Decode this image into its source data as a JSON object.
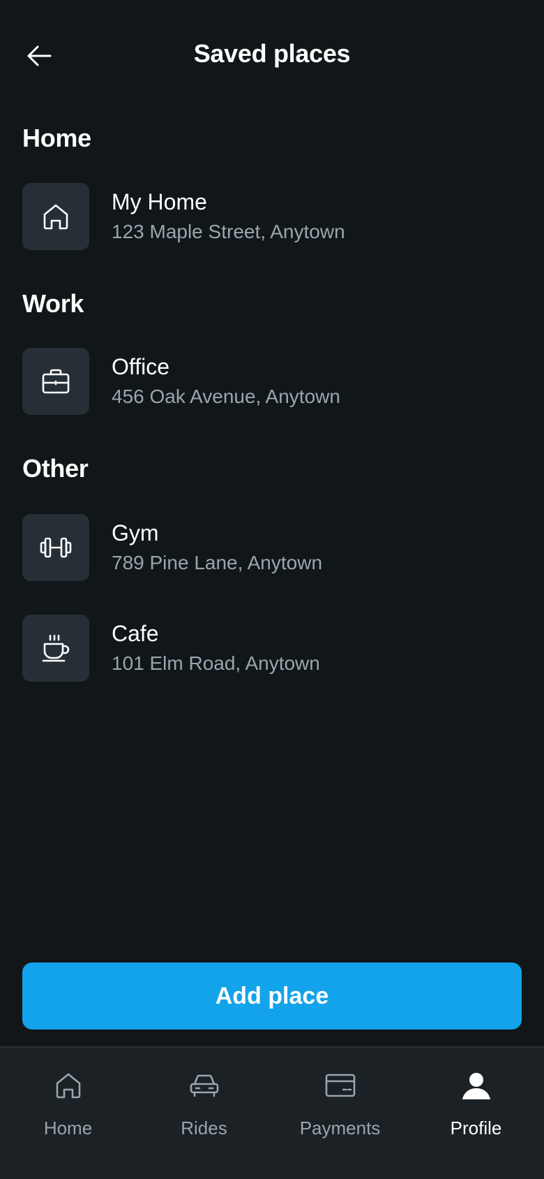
{
  "header": {
    "back_icon": "arrow-left-icon",
    "title": "Saved places"
  },
  "sections": {
    "home": {
      "title": "Home",
      "places": [
        {
          "icon": "house-icon",
          "name": "My Home",
          "address": "123 Maple Street, Anytown"
        }
      ]
    },
    "work": {
      "title": "Work",
      "places": [
        {
          "icon": "briefcase-icon",
          "name": "Office",
          "address": "456 Oak Avenue, Anytown"
        }
      ]
    },
    "other": {
      "title": "Other",
      "places": [
        {
          "icon": "dumbbell-icon",
          "name": "Gym",
          "address": "789 Pine Lane, Anytown"
        },
        {
          "icon": "coffee-cup-icon",
          "name": "Cafe",
          "address": "101 Elm Road, Anytown"
        }
      ]
    }
  },
  "add_button": {
    "label": "Add place"
  },
  "bottom_nav": {
    "items": [
      {
        "label": "Home",
        "icon": "home-icon",
        "active": false
      },
      {
        "label": "Rides",
        "icon": "car-icon",
        "active": false
      },
      {
        "label": "Payments",
        "icon": "credit-card-icon",
        "active": false
      },
      {
        "label": "Profile",
        "icon": "user-icon",
        "active": true
      }
    ]
  },
  "colors": {
    "background": "#111619",
    "card": "#262f35",
    "accent": "#13a3ea",
    "muted_text": "#9aa6ae",
    "nav_background": "#1b2124"
  }
}
